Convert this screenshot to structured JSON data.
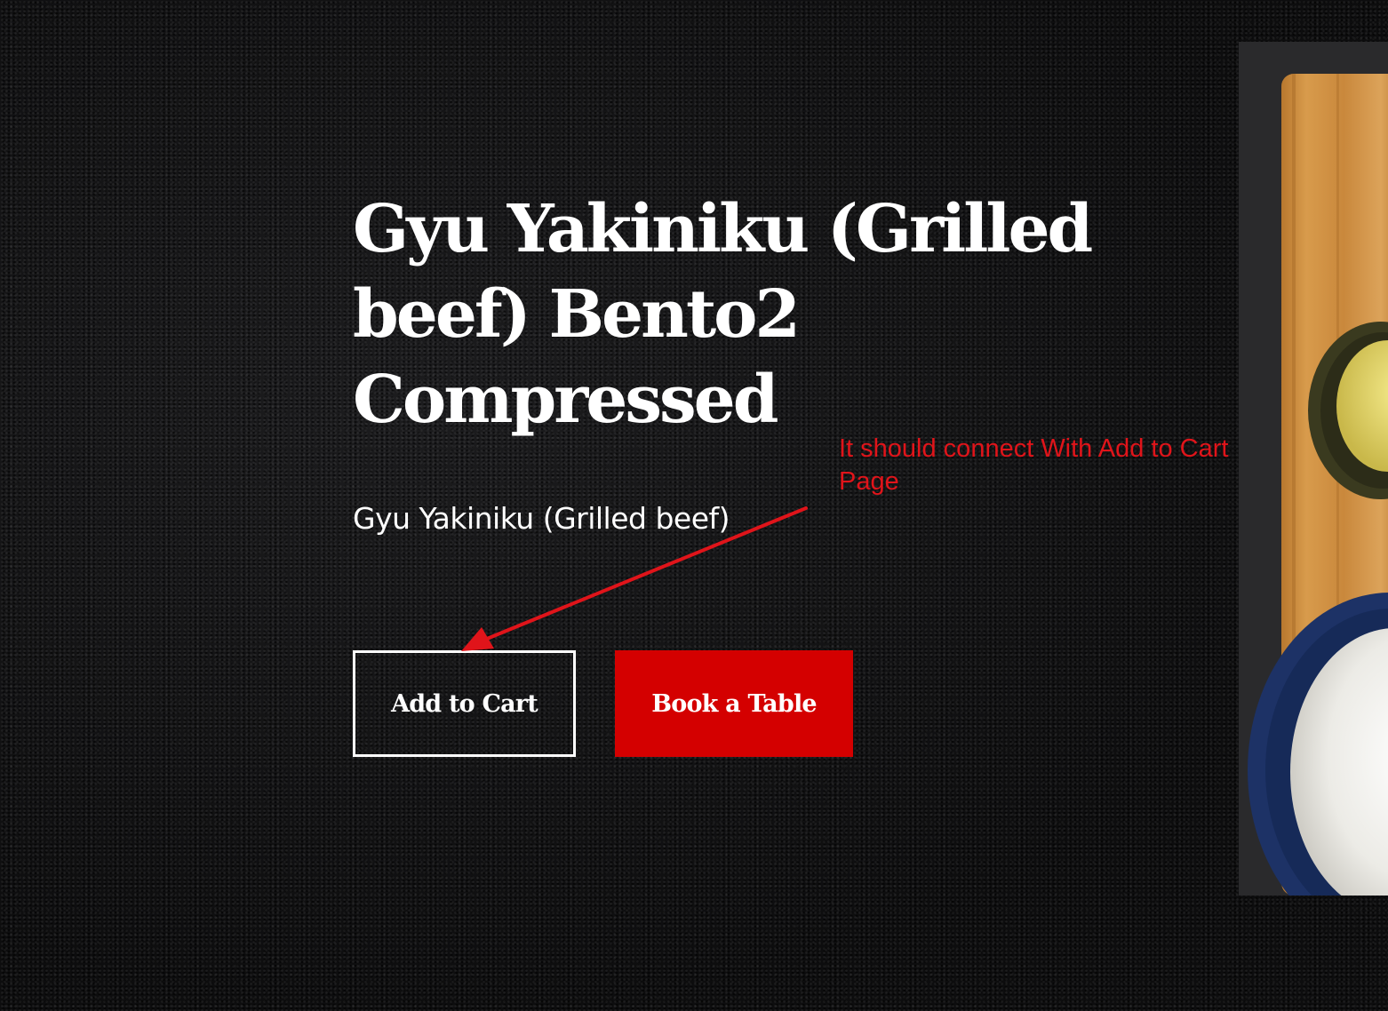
{
  "product": {
    "title": "Gyu Yakiniku (Grilled beef) Bento2 Compressed",
    "subtitle": "Gyu Yakiniku (Grilled beef)"
  },
  "actions": {
    "add_to_cart_label": "Add to Cart",
    "book_table_label": "Book a Table"
  },
  "annotation": {
    "note": "It should connect With Add to Cart Page",
    "color": "#e0141a"
  },
  "colors": {
    "background": "#0f0f10",
    "primary_button": "#d40000",
    "text": "#ffffff"
  },
  "photo": {
    "icon": "bento-food-photo"
  }
}
